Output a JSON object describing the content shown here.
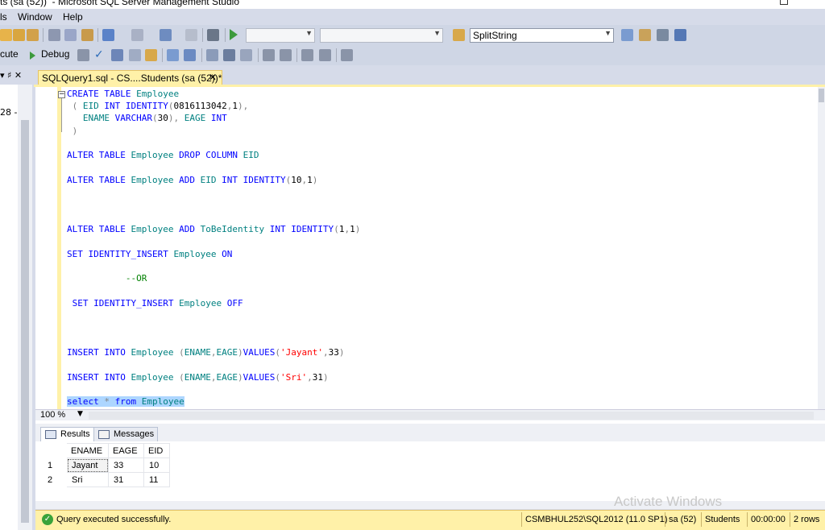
{
  "title_bar": {
    "text": "ts (sa (52))  - Microsoft SQL Server Management Studio"
  },
  "menu": {
    "items": [
      "ls",
      "Window",
      "Help"
    ]
  },
  "toolbar": {
    "database_combo": "",
    "server_combo": "",
    "search_combo": "SplitString",
    "execute_label": "cute",
    "debug_label": "Debug"
  },
  "object_explorer": {
    "pin_label": "▾ ♯ ✕",
    "node_text": "28 - :"
  },
  "document_tab": {
    "title": "SQLQuery1.sql - CS....Students (sa (52))*",
    "close": "✕"
  },
  "editor": {
    "zoom": "100 %"
  },
  "results_tabs": {
    "results": "Results",
    "messages": "Messages"
  },
  "results_grid": {
    "columns": [
      "ENAME",
      "EAGE",
      "EID"
    ],
    "rows": [
      {
        "num": "1",
        "cells": [
          "Jayant",
          "33",
          "10"
        ]
      },
      {
        "num": "2",
        "cells": [
          "Sri",
          "31",
          "11"
        ]
      }
    ]
  },
  "watermark": "Activate Windows",
  "status_bar": {
    "message": "Query executed successfully.",
    "server": "CSMBHUL252\\SQL2012 (11.0 SP1)",
    "user": "sa (52)",
    "database": "Students",
    "elapsed": "00:00:00",
    "rows": "2 rows"
  }
}
